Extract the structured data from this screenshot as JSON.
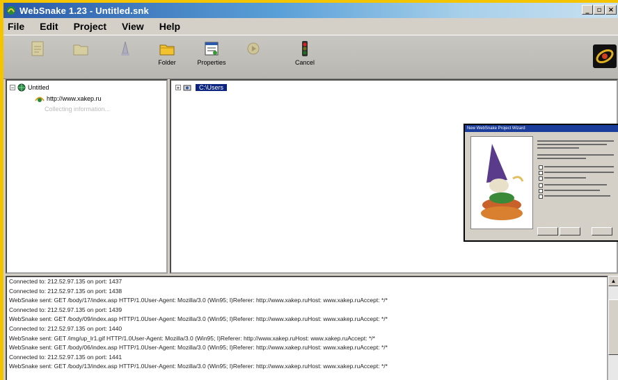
{
  "window": {
    "title": "WebSnake 1.23 - Untitled.snk",
    "buttons": [
      "_",
      "▫",
      "×"
    ]
  },
  "menu": [
    "File",
    "Edit",
    "Project",
    "View",
    "Help"
  ],
  "toolbar": {
    "folder_label": "Folder",
    "properties_label": "Properties",
    "cancel_label": "Cancel"
  },
  "tree": {
    "root": "Untitled",
    "site": "http://www.xakep.ru",
    "sub": "Collecting information..."
  },
  "right": {
    "selected": "C:\\Users"
  },
  "dialog": {
    "title": "New WebSnake Project Wizard"
  },
  "log": [
    "Connected to: 212.52.97.135 on port: 1437",
    "Connected to: 212.52.97.135 on port: 1438",
    "WebSnake sent: GET /body/17/index.asp HTTP/1.0User-Agent: Mozilla/3.0 (Win95; I)Referer: http://www.xakep.ruHost: www.xakep.ruAccept: */*",
    "Connected to: 212.52.97.135 on port: 1439",
    "WebSnake sent: GET /body/09/index.asp HTTP/1.0User-Agent: Mozilla/3.0 (Win95; I)Referer: http://www.xakep.ruHost: www.xakep.ruAccept: */*",
    "Connected to: 212.52.97.135 on port: 1440",
    "WebSnake sent: GET /img/up_lr1.gif HTTP/1.0User-Agent: Mozilla/3.0 (Win95; I)Referer: http://www.xakep.ruHost: www.xakep.ruAccept: */*",
    "WebSnake sent: GET /body/06/index.asp HTTP/1.0User-Agent: Mozilla/3.0 (Win95; I)Referer: http://www.xakep.ruHost: www.xakep.ruAccept: */*",
    "Connected to: 212.52.97.135 on port: 1441",
    "WebSnake sent: GET /body/13/index.asp HTTP/1.0User-Agent: Mozilla/3.0 (Win95; I)Referer: http://www.xakep.ruHost: www.xakep.ruAccept: */*"
  ],
  "colors": {
    "frame": "#f5c400",
    "titlebar_start": "#2a5aa8",
    "selection": "#0a2480"
  }
}
